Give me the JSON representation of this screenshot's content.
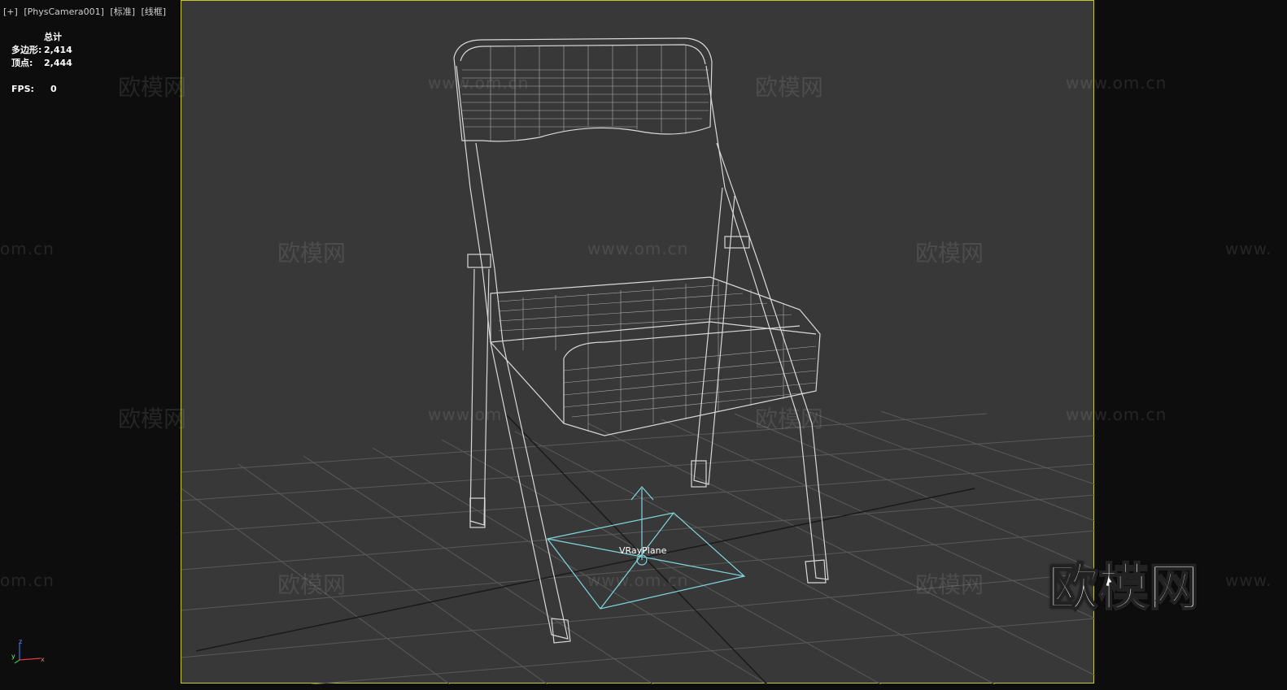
{
  "viewport": {
    "menu": [
      "[+]",
      "[PhysCamera001]",
      "[标准]",
      "[线框]"
    ]
  },
  "stats": {
    "header": "总计",
    "polygons_label": "多边形:",
    "polygons_value": "2,414",
    "vertices_label": "顶点:",
    "vertices_value": "2,444",
    "fps_label": "FPS:",
    "fps_value": "0"
  },
  "scene": {
    "object_label": "VRayPlane",
    "wireframe_color": "#d8d8d8",
    "grid_color": "#5a5a5a",
    "light_color": "#7fd6e0",
    "frame_color": "#c8c832"
  },
  "watermarks": {
    "brand": "欧模网",
    "url": "www.om.cn",
    "url_partial_left": "om.cn",
    "url_partial_right": "www.",
    "url_partial_mid": "www.om",
    "big_logo": "欧模网"
  },
  "axis": {
    "x": "x",
    "y": "y",
    "z": "z"
  }
}
